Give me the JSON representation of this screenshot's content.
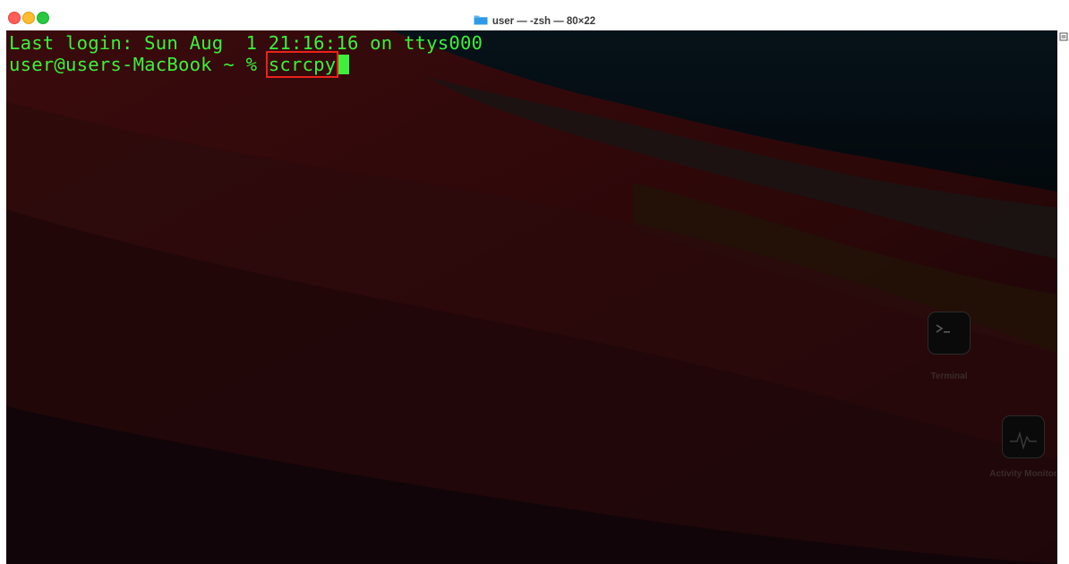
{
  "window": {
    "title": "user — -zsh — 80×22",
    "traffic_lights": [
      "close",
      "minimize",
      "maximize"
    ]
  },
  "terminal": {
    "lines": [
      "Last login: Sun Aug  1 21:16:16 on ttys000",
      "user@users-MacBook ~ % "
    ],
    "command": "scrcpy",
    "text_color": "#3cf03c",
    "highlight_color": "#e8221c"
  },
  "desktop_icons": [
    {
      "label": "Terminal",
      "icon": "terminal-app-icon"
    },
    {
      "label": "Activity Monitor",
      "icon": "activity-monitor-app-icon"
    }
  ]
}
